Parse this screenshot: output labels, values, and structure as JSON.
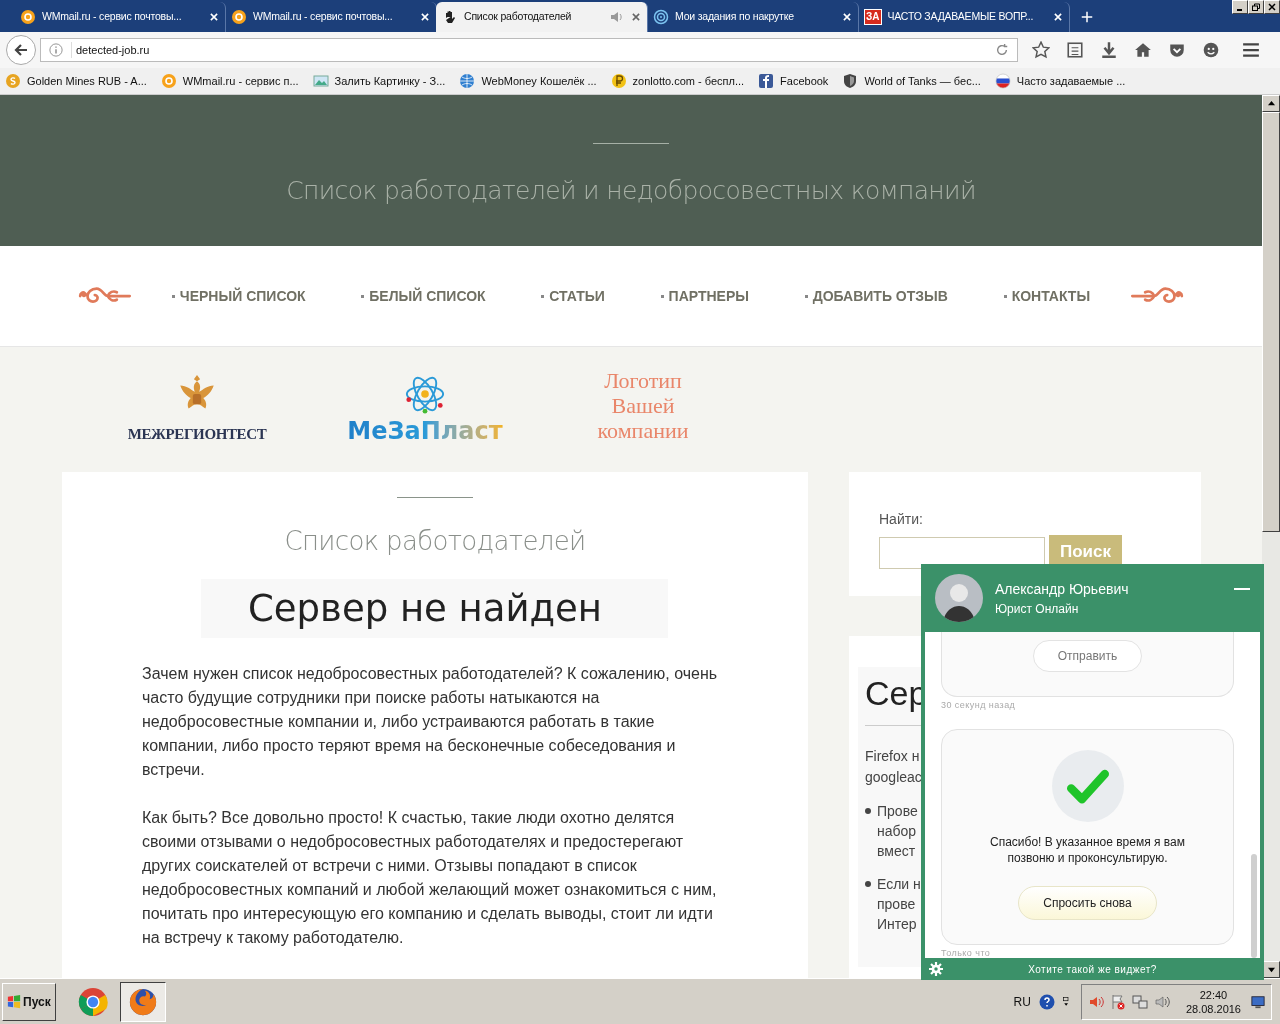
{
  "browser": {
    "tabs": [
      {
        "title": "WMmail.ru - сервис почтовы...",
        "kind": "at",
        "audio": false,
        "selected": false
      },
      {
        "title": "WMmail.ru - сервис почтовы...",
        "kind": "at",
        "audio": false,
        "selected": false
      },
      {
        "title": "Список работодателей",
        "kind": "hand",
        "audio": true,
        "selected": true
      },
      {
        "title": "Мои задания по накрутке",
        "kind": "spiral",
        "audio": false,
        "selected": false
      },
      {
        "title": "ЧАСТО ЗАДАВАЕМЫЕ ВОПР...",
        "kind": "badge",
        "badge": "ЗА",
        "audio": false,
        "selected": false
      }
    ],
    "url": "detected-job.ru",
    "bookmarks": [
      {
        "label": "Golden Mines RUB - A...",
        "kind": "coin"
      },
      {
        "label": "WMmail.ru - сервис п...",
        "kind": "at"
      },
      {
        "label": "Залить Картинку - З...",
        "kind": "image"
      },
      {
        "label": "WebMoney Кошелёк ...",
        "kind": "globe"
      },
      {
        "label": "zonlotto.com - беспл...",
        "kind": "ruble"
      },
      {
        "label": "Facebook",
        "kind": "facebook"
      },
      {
        "label": "World of Tanks — бес...",
        "kind": "shield"
      },
      {
        "label": "Часто задаваемые ...",
        "kind": "flag"
      }
    ]
  },
  "site": {
    "subtitle": "Список работодателей и недобросовестных компаний",
    "nav": [
      "ЧЕРНЫЙ СПИСОК",
      "БЕЛЫЙ СПИСОК",
      "СТАТЬИ",
      "ПАРТНЕРЫ",
      "ДОБАВИТЬ ОТЗЫВ",
      "КОНТАКТЫ"
    ],
    "logos": [
      {
        "kind": "emblem",
        "text": "МЕЖРЕГИОНТЕСТ"
      },
      {
        "kind": "atom",
        "text": "МеЗаПласт"
      },
      {
        "kind": "placeholder",
        "text": "Логотип Вашей компании"
      }
    ],
    "main": {
      "title": "Список работодателей",
      "error": "Сервер не найден",
      "paragraphs": [
        "Зачем нужен список недобросовестных работодателей? К сожалению, очень часто будущие сотрудники при поиске работы натыкаются на недобросовестные компании и, либо устраиваются работать в такие компании, либо просто теряют время на бесконечные собеседования и встречи.",
        "Как быть? Все довольно просто! К счастью, такие люди охотно делятся своими отзывами о недобросовестных работодателях и предостерегают других соискателей от встречи с ними. Отзывы попадают в список недобросовестных компаний и любой желающий может ознакомиться с ним, почитать про интересующую его компанию и сделать выводы, стоит ли идти на встречу к такому работодателю."
      ]
    },
    "search": {
      "label": "Найти:",
      "button": "Поиск"
    },
    "sidebar_card": {
      "heading": "Сер",
      "lines": [
        "Firefox н",
        "googleac"
      ],
      "bullets": [
        [
          "Прове",
          "набор",
          "вмест"
        ],
        [
          "Если н",
          "прове",
          "Интер"
        ]
      ]
    }
  },
  "chat": {
    "agent_name": "Александр Юрьевич",
    "agent_role": "Юрист Онлайн",
    "messages": [
      {
        "kind": "form",
        "button": "Отправить",
        "time": "30 секунд назад"
      },
      {
        "kind": "success",
        "text": "Спасибо! В указанное время я вам позвоню и проконсультирую.",
        "button": "Спросить снова",
        "time": "Только что"
      }
    ],
    "footer": "Хотите такой же виджет?"
  },
  "taskbar": {
    "start": "Пуск",
    "apps": [
      {
        "kind": "chrome",
        "selected": false
      },
      {
        "kind": "firefox",
        "selected": true
      }
    ],
    "lang": "RU",
    "time": "22:40",
    "date": "28.08.2016"
  }
}
